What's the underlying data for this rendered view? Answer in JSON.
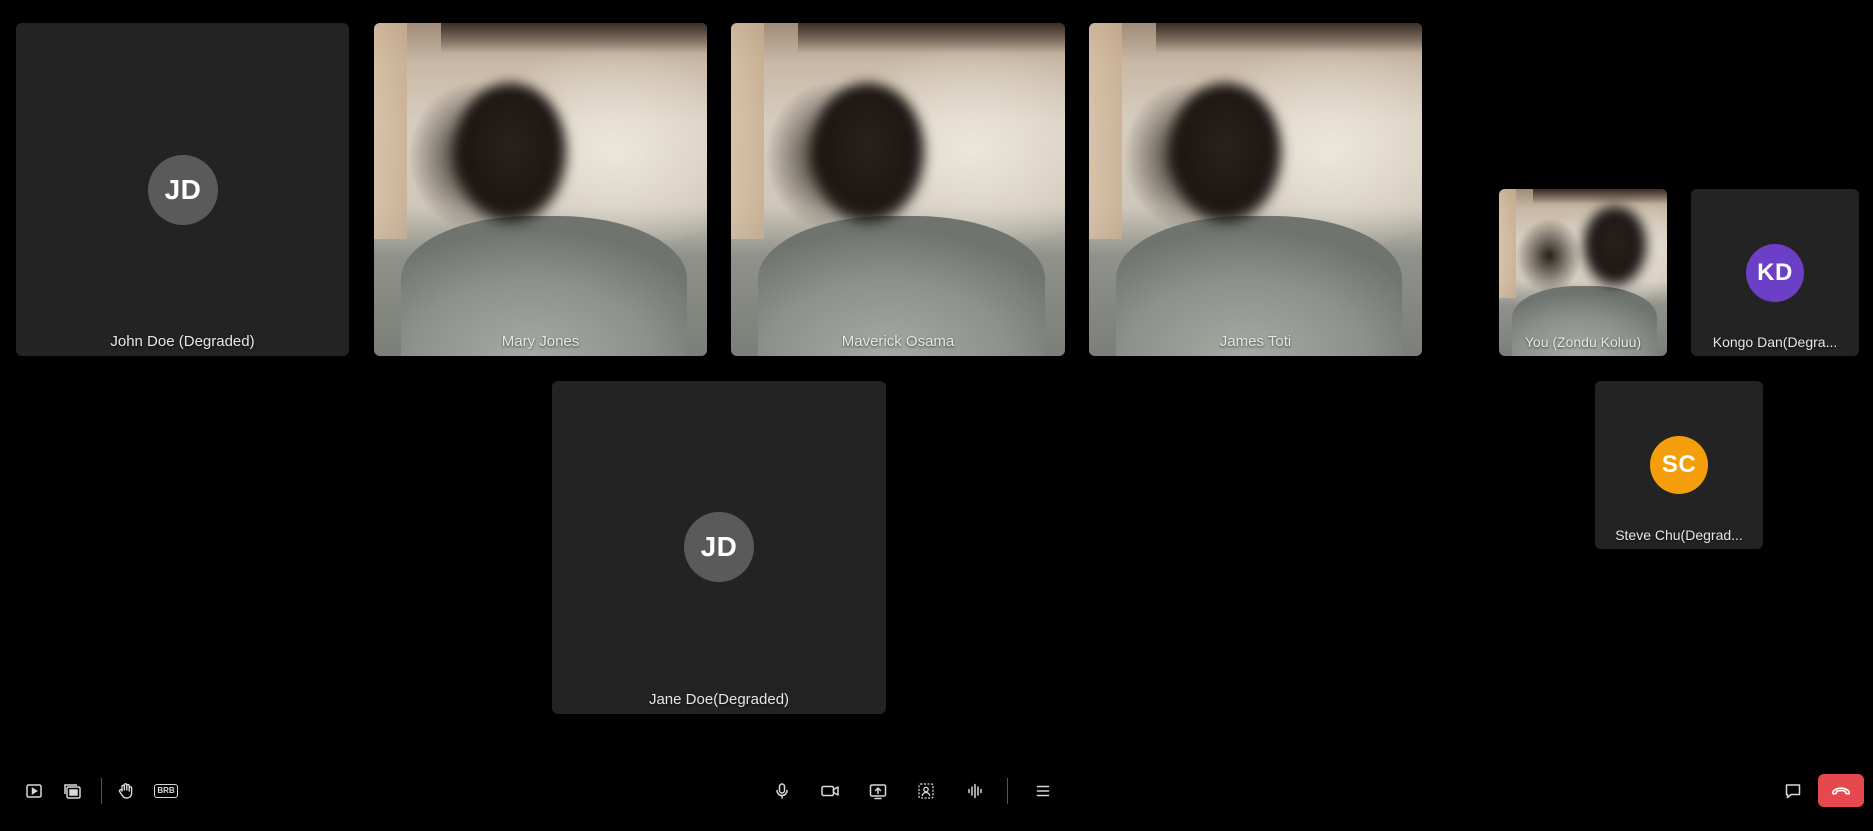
{
  "participants": {
    "john_doe": {
      "name": "John Doe (Degraded)",
      "initials": "JD",
      "avatar_color": "#5a5a5a"
    },
    "mary_jones": {
      "name": "Mary Jones"
    },
    "maverick_osama": {
      "name": "Maverick Osama"
    },
    "james_toti": {
      "name": "James Toti"
    },
    "you": {
      "name": "You (Zondu Koluu)"
    },
    "kongo_dan": {
      "name": "Kongo Dan(Degra...",
      "initials": "KD",
      "avatar_color": "#6b3fc6"
    },
    "jane_doe": {
      "name": "Jane Doe(Degraded)",
      "initials": "JD",
      "avatar_color": "#5a5a5a"
    },
    "steve_chu": {
      "name": "Steve Chu(Degrad...",
      "initials": "SC",
      "avatar_color": "#f59e0b"
    }
  },
  "toolbar": {
    "left": [
      "picture-in-picture-icon",
      "screen-record-icon",
      "raise-hand-icon",
      "brb-icon"
    ],
    "brb_label": "BRB",
    "center": [
      "microphone-icon",
      "camera-icon",
      "share-screen-icon",
      "background-effects-icon",
      "noise-suppression-icon",
      "menu-icon"
    ],
    "right": [
      "chat-icon",
      "end-call-icon"
    ],
    "end_call_color": "#e5484d"
  }
}
